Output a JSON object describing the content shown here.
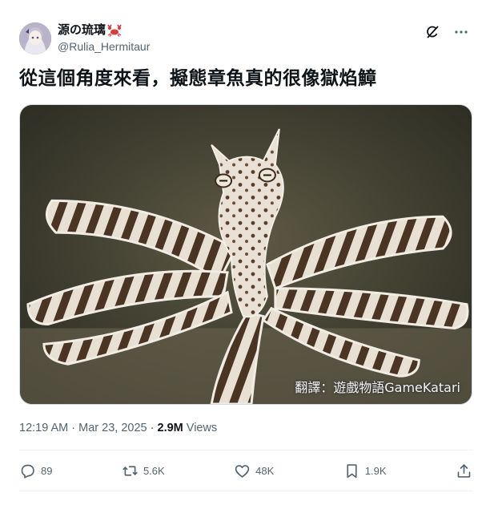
{
  "author": {
    "display_name": "源の琉璃",
    "emoji": "crab",
    "handle": "@Rulia_Hermitaur"
  },
  "header_icons": [
    "grok-icon",
    "more-icon"
  ],
  "tweet": {
    "text": "從這個角度來看，擬態章魚真的很像獄焰鱆"
  },
  "media": {
    "description_icon": "octopus-photo",
    "watermark": "翻譯：遊戲物語GameKatari"
  },
  "meta": {
    "time": "12:19 AM",
    "separator": " · ",
    "date": "Mar 23, 2025",
    "dot": " · ",
    "views_count": "2.9M",
    "views_label": " Views"
  },
  "actions": {
    "replies": "89",
    "reposts": "5.6K",
    "likes": "48K",
    "bookmarks": "1.9K"
  },
  "colors": {
    "text": "#0f1419",
    "secondary": "#536471",
    "divider": "#eff3f4"
  }
}
